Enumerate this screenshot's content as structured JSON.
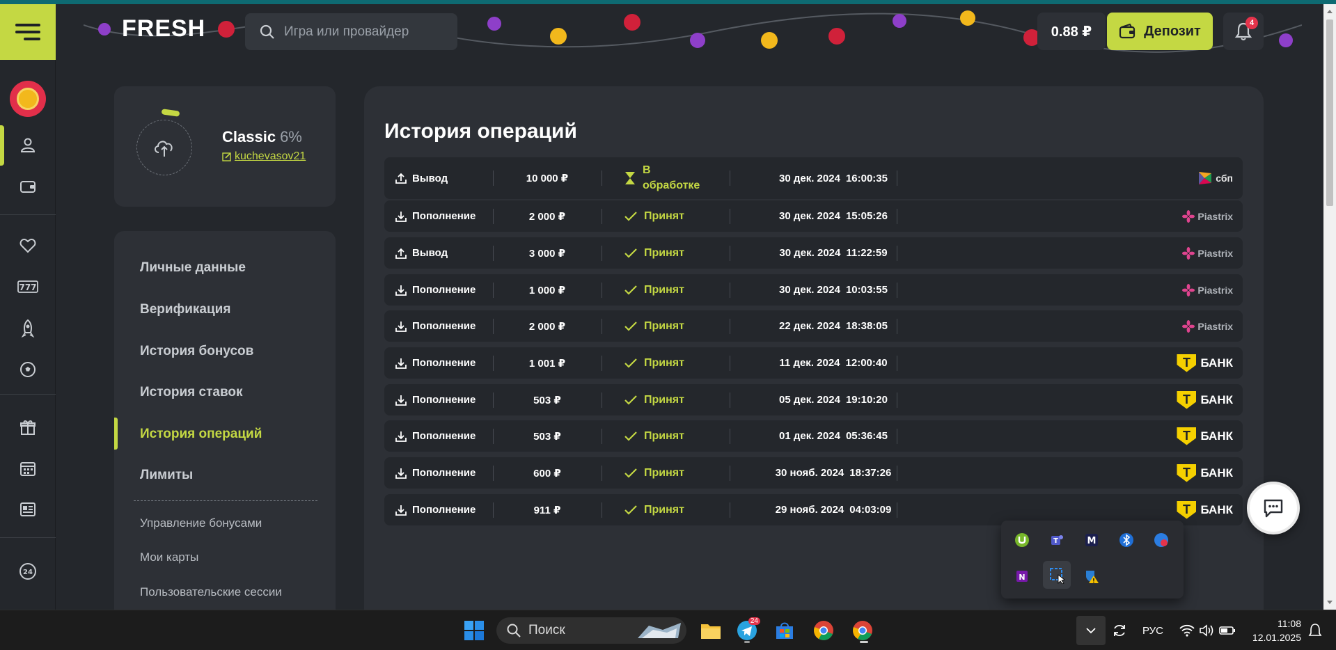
{
  "header": {
    "logo_text": "FRESH",
    "search_placeholder": "Игра или провайдер",
    "balance": "0.88 ₽",
    "deposit_label": "Депозит",
    "notifications_count": "4"
  },
  "profile": {
    "level_name": "Classic",
    "level_percent": "6%",
    "username": "kuchevasov21"
  },
  "menu": {
    "items": [
      {
        "label": "Личные данные"
      },
      {
        "label": "Верификация"
      },
      {
        "label": "История бонусов"
      },
      {
        "label": "История ставок"
      },
      {
        "label": "История операций"
      },
      {
        "label": "Лимиты"
      }
    ],
    "sub_items": [
      {
        "label": "Управление бонусами"
      },
      {
        "label": "Мои карты"
      },
      {
        "label": "Пользовательские сессии"
      }
    ],
    "active_index": 4
  },
  "panel": {
    "title": "История операций"
  },
  "operations": [
    {
      "type": "Вывод",
      "direction": "out",
      "amount": "10 000 ₽",
      "status": "В обработке",
      "status_kind": "pending",
      "date": "30 дек. 2024",
      "time": "16:00:35",
      "provider": "СБП"
    },
    {
      "type": "Пополнение",
      "direction": "in",
      "amount": "2 000 ₽",
      "status": "Принят",
      "status_kind": "accepted",
      "date": "30 дек. 2024",
      "time": "15:05:26",
      "provider": "Piastrix"
    },
    {
      "type": "Вывод",
      "direction": "out",
      "amount": "3 000 ₽",
      "status": "Принят",
      "status_kind": "accepted",
      "date": "30 дек. 2024",
      "time": "11:22:59",
      "provider": "Piastrix"
    },
    {
      "type": "Пополнение",
      "direction": "in",
      "amount": "1 000 ₽",
      "status": "Принят",
      "status_kind": "accepted",
      "date": "30 дек. 2024",
      "time": "10:03:55",
      "provider": "Piastrix"
    },
    {
      "type": "Пополнение",
      "direction": "in",
      "amount": "2 000 ₽",
      "status": "Принят",
      "status_kind": "accepted",
      "date": "22 дек. 2024",
      "time": "18:38:05",
      "provider": "Piastrix"
    },
    {
      "type": "Пополнение",
      "direction": "in",
      "amount": "1 001 ₽",
      "status": "Принят",
      "status_kind": "accepted",
      "date": "11 дек. 2024",
      "time": "12:00:40",
      "provider": "БАНК"
    },
    {
      "type": "Пополнение",
      "direction": "in",
      "amount": "503 ₽",
      "status": "Принят",
      "status_kind": "accepted",
      "date": "05 дек. 2024",
      "time": "19:10:20",
      "provider": "БАНК"
    },
    {
      "type": "Пополнение",
      "direction": "in",
      "amount": "503 ₽",
      "status": "Принят",
      "status_kind": "accepted",
      "date": "01 дек. 2024",
      "time": "05:36:45",
      "provider": "БАНК"
    },
    {
      "type": "Пополнение",
      "direction": "in",
      "amount": "600 ₽",
      "status": "Принят",
      "status_kind": "accepted",
      "date": "30 нояб. 2024",
      "time": "18:37:26",
      "provider": "БАНК"
    },
    {
      "type": "Пополнение",
      "direction": "in",
      "amount": "911 ₽",
      "status": "Принят",
      "status_kind": "accepted",
      "date": "29 нояб. 2024",
      "time": "04:03:09",
      "provider": "БАНК"
    }
  ],
  "provider_logos": {
    "sbp_text": "сбп",
    "piastrix_text": "Piastrix",
    "tbank_letter": "Т",
    "tbank_text": "БАНК"
  },
  "taskbar": {
    "search_label": "Поиск",
    "telegram_badge": "24",
    "language": "РУС",
    "time": "11:08",
    "date": "12.01.2025"
  },
  "colors": {
    "accent": "#c4d843",
    "background": "#24272c",
    "card": "#2d3036",
    "badge_red": "#e5334b"
  }
}
